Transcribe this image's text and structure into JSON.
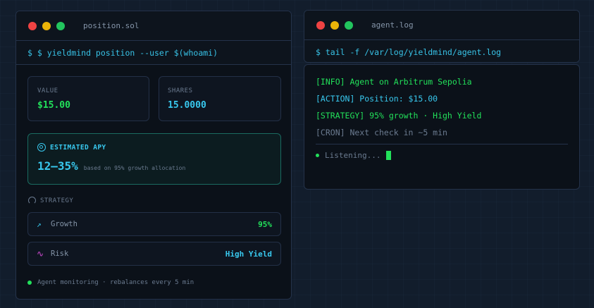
{
  "colors": {
    "green": "#22e05a",
    "cyan": "#38c8ee",
    "accent_border": "#1a6b60",
    "risk_icon": "#d44bd6"
  },
  "left_window": {
    "title": "position.sol",
    "command": "$ $ yieldmind position --user $(whoami)",
    "value_card": {
      "label": "VALUE",
      "value": "$15.00"
    },
    "shares_card": {
      "label": "SHARES",
      "value": "15.0000"
    },
    "apy_card": {
      "icon": "target-icon",
      "label": "ESTIMATED APY",
      "value": "12–35%",
      "note": "based on 95% growth allocation"
    },
    "strategy": {
      "icon": "gauge-icon",
      "label": "STRATEGY",
      "rows": [
        {
          "icon": "trending-up-icon",
          "label": "Growth",
          "value": "95%"
        },
        {
          "icon": "activity-icon",
          "label": "Risk",
          "value": "High Yield"
        }
      ]
    },
    "footer": "Agent monitoring · rebalances every 5 min"
  },
  "right_window": {
    "title": "agent.log",
    "command": "$ tail -f /var/log/yieldmind/agent.log",
    "lines": [
      "[INFO] Agent on Arbitrum Sepolia",
      "[ACTION] Position: $15.00",
      "[STRATEGY] 95% growth · High Yield",
      "[CRON] Next check in ~5 min"
    ],
    "listening": "Listening..."
  }
}
